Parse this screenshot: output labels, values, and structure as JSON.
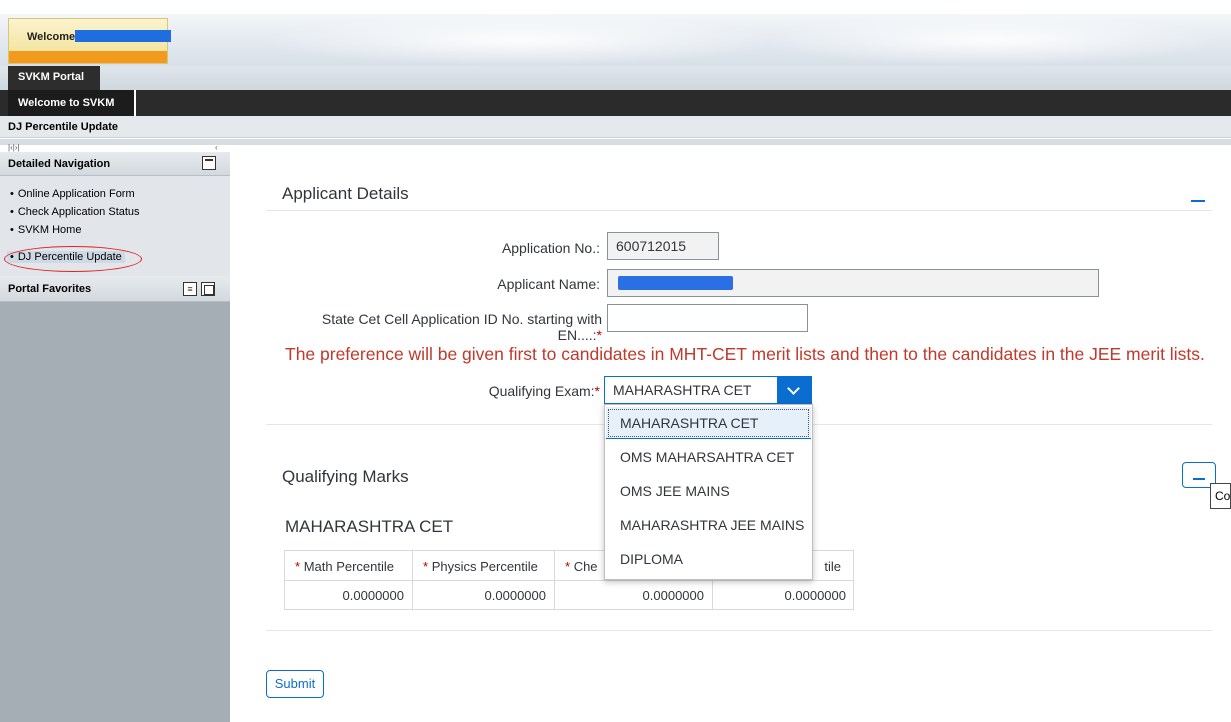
{
  "header": {
    "welcome_label": "Welcome"
  },
  "tabs": {
    "portal": "SVKM Portal",
    "sub": "Welcome to SVKM",
    "breadcrumb": "DJ Percentile Update",
    "pager": "|‹|›|",
    "pager_right": "‹"
  },
  "sidebar": {
    "title": "Detailed Navigation",
    "items": [
      {
        "label": "Online Application Form"
      },
      {
        "label": "Check Application Status"
      },
      {
        "label": "SVKM Home"
      },
      {
        "label": "DJ Percentile Update"
      }
    ],
    "favorites_title": "Portal Favorites",
    "bullet": "•"
  },
  "applicant": {
    "section_title": "Applicant Details",
    "app_no_label": "Application No.:",
    "app_no_value": "600712015",
    "name_label": "Applicant Name:",
    "cet_label": "State Cet Cell Application ID No. starting with EN....:",
    "required_mark": "*",
    "notice": "The preference will be given first to candidates in MHT-CET merit lists and then to the candidates in the JEE merit lists.",
    "exam_label": "Qualifying Exam:",
    "exam_value": "MAHARASHTRA CET"
  },
  "dropdown": {
    "options": [
      "MAHARASHTRA CET",
      "OMS MAHARSAHTRA CET",
      "OMS JEE MAINS",
      "MAHARASHTRA JEE MAINS",
      "DIPLOMA"
    ],
    "selected_index": 0
  },
  "marks": {
    "section_title": "Qualifying Marks",
    "subtitle": "MAHARASHTRA CET",
    "columns": [
      "Math Percentile",
      "Physics Percentile",
      "Che",
      "tile"
    ],
    "values": [
      "0.0000000",
      "0.0000000",
      "0.0000000",
      "0.0000000"
    ],
    "tooltip": "Co"
  },
  "actions": {
    "submit": "Submit"
  },
  "colors": {
    "accent": "#0a6ed1",
    "notice": "#c0392b",
    "required": "#bb0000",
    "sidebar": "#a6aeb5"
  }
}
